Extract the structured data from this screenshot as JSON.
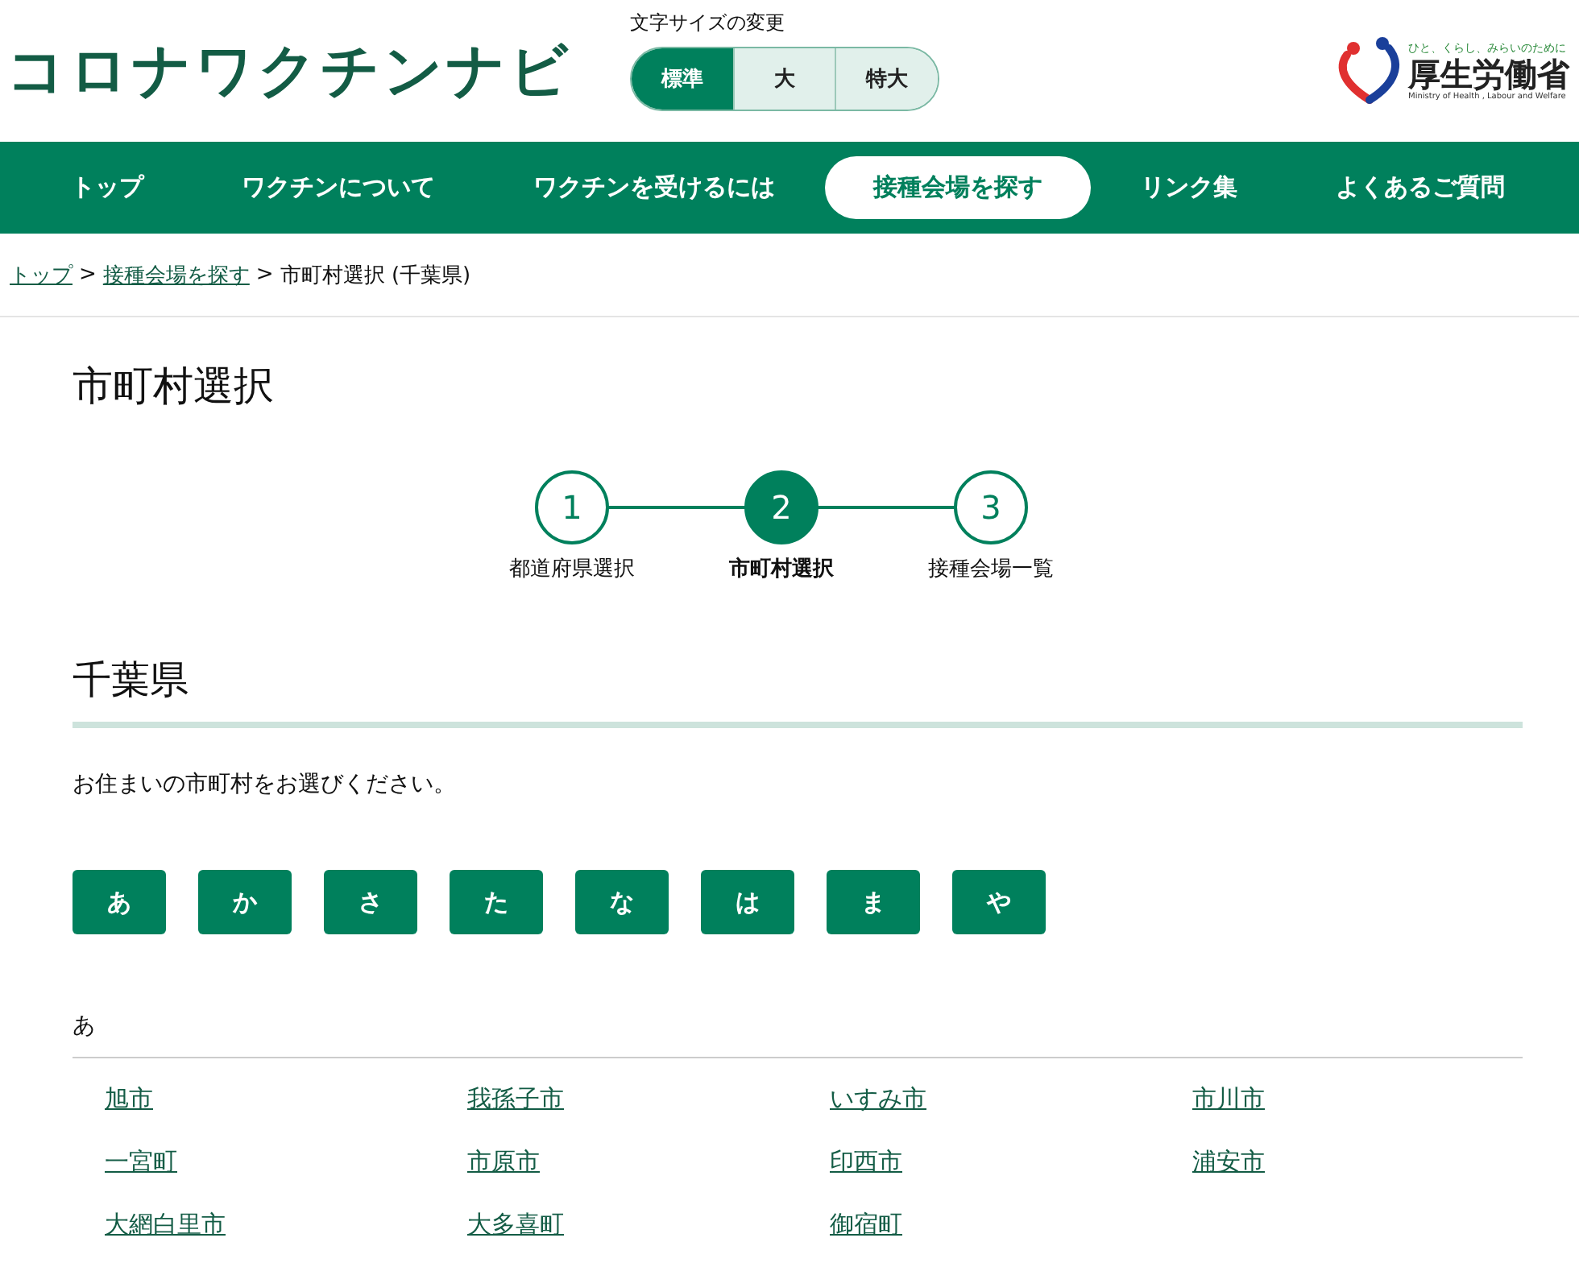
{
  "header": {
    "site_title": "コロナワクチンナビ",
    "font_size": {
      "label": "文字サイズの変更",
      "options": [
        {
          "label": "標準",
          "selected": true
        },
        {
          "label": "大",
          "selected": false
        },
        {
          "label": "特大",
          "selected": false
        }
      ]
    },
    "ministry_logo": {
      "tagline": "ひと、くらし、みらいのために",
      "name": "厚生労働省",
      "english": "Ministry of Health , Labour and Welfare"
    }
  },
  "nav": [
    {
      "label": "トップ",
      "selected": false
    },
    {
      "label": "ワクチンについて",
      "selected": false
    },
    {
      "label": "ワクチンを受けるには",
      "selected": false
    },
    {
      "label": "接種会場を探す",
      "selected": true
    },
    {
      "label": "リンク集",
      "selected": false
    },
    {
      "label": "よくあるご質問",
      "selected": false
    }
  ],
  "breadcrumb": {
    "links": [
      "トップ",
      "接種会場を探す"
    ],
    "separator": ">",
    "current": "市町村選択 (千葉県)"
  },
  "page_title": "市町村選択",
  "steps": [
    {
      "number": "1",
      "label": "都道府県選択",
      "selected": false
    },
    {
      "number": "2",
      "label": "市町村選択",
      "selected": true
    },
    {
      "number": "3",
      "label": "接種会場一覧",
      "selected": false
    }
  ],
  "prefecture": "千葉県",
  "instruction": "お住まいの市町村をお選びください。",
  "kana_buttons": [
    "あ",
    "か",
    "さ",
    "た",
    "な",
    "は",
    "ま",
    "や"
  ],
  "section": {
    "heading": "あ",
    "municipalities": [
      "旭市",
      "我孫子市",
      "いすみ市",
      "市川市",
      "一宮町",
      "市原市",
      "印西市",
      "浦安市",
      "大網白里市",
      "大多喜町",
      "御宿町"
    ]
  }
}
